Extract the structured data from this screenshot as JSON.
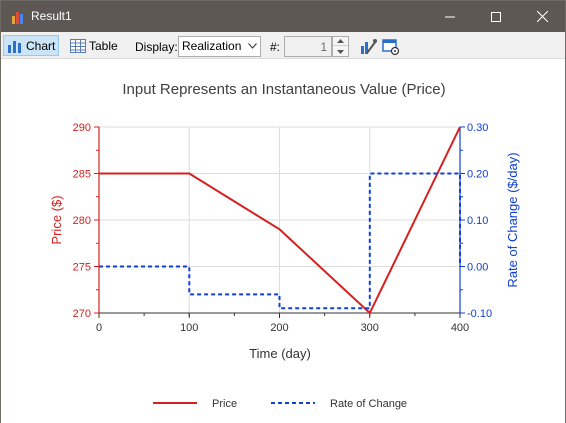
{
  "window": {
    "title": "Result1",
    "controls": {
      "minimize": "minimize-icon",
      "maximize": "maximize-icon",
      "close": "close-icon"
    }
  },
  "toolbar": {
    "chart_tab": "Chart",
    "table_tab": "Table",
    "display_label": "Display:",
    "display_value": "Realization",
    "number_label": "#:",
    "number_value": "1",
    "icons": [
      "chart-properties-icon",
      "result-options-icon"
    ]
  },
  "colors": {
    "price": "#d62020",
    "rate": "#1040d8",
    "grid": "#dcdcdc",
    "title_text": "#404040"
  },
  "chart_data": {
    "type": "line",
    "title": "Input Represents an Instantaneous Value (Price)",
    "xlabel": "Time (day)",
    "ylabel_left": "Price ($)",
    "ylabel_right": "Rate of Change ($/day)",
    "xlim": [
      0,
      400
    ],
    "ylim_left": [
      270,
      290
    ],
    "ylim_right": [
      -0.1,
      0.3
    ],
    "x_ticks": [
      "0",
      "100",
      "200",
      "300",
      "400"
    ],
    "y_ticks_left": [
      "270",
      "275",
      "280",
      "285",
      "290"
    ],
    "y_ticks_right": [
      "-0.10",
      "0.00",
      "0.10",
      "0.20",
      "0.30"
    ],
    "grid": true,
    "legend_position": "bottom",
    "series": [
      {
        "name": "Price",
        "axis": "left",
        "style": "solid",
        "x": [
          0,
          100,
          200,
          300,
          400
        ],
        "y": [
          285,
          285,
          279,
          270,
          290
        ]
      },
      {
        "name": "Rate of Change",
        "axis": "right",
        "style": "dashed-step",
        "x": [
          0,
          100,
          100,
          200,
          200,
          300,
          300,
          400,
          400
        ],
        "y": [
          0,
          0,
          -0.06,
          -0.06,
          -0.09,
          -0.09,
          0.2,
          0.2,
          0
        ]
      }
    ]
  }
}
